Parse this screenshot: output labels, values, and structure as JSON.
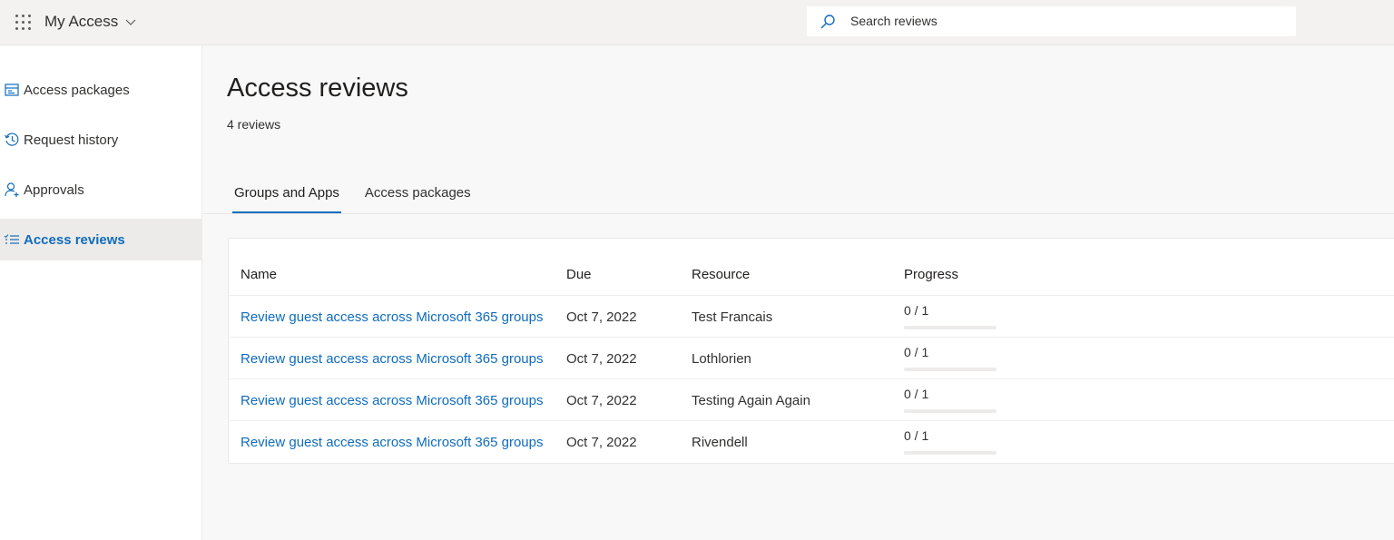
{
  "header": {
    "app_title": "My Access",
    "search_placeholder": "Search reviews"
  },
  "sidebar": {
    "items": [
      {
        "label": "Access packages",
        "icon": "package-icon",
        "active": false
      },
      {
        "label": "Request history",
        "icon": "history-icon",
        "active": false
      },
      {
        "label": "Approvals",
        "icon": "person-add-icon",
        "active": false
      },
      {
        "label": "Access reviews",
        "icon": "checklist-icon",
        "active": true
      }
    ]
  },
  "main": {
    "title": "Access reviews",
    "subtitle": "4 reviews",
    "tabs": [
      {
        "label": "Groups and Apps",
        "active": true
      },
      {
        "label": "Access packages",
        "active": false
      }
    ],
    "table": {
      "columns": [
        "Name",
        "Due",
        "Resource",
        "Progress"
      ],
      "rows": [
        {
          "name": "Review guest access across Microsoft 365 groups",
          "due": "Oct 7, 2022",
          "resource": "Test Francais",
          "progress": "0 / 1",
          "progress_fraction": 0
        },
        {
          "name": "Review guest access across Microsoft 365 groups",
          "due": "Oct 7, 2022",
          "resource": "Lothlorien",
          "progress": "0 / 1",
          "progress_fraction": 0
        },
        {
          "name": "Review guest access across Microsoft 365 groups",
          "due": "Oct 7, 2022",
          "resource": "Testing Again Again",
          "progress": "0 / 1",
          "progress_fraction": 0
        },
        {
          "name": "Review guest access across Microsoft 365 groups",
          "due": "Oct 7, 2022",
          "resource": "Rivendell",
          "progress": "0 / 1",
          "progress_fraction": 0
        }
      ]
    }
  },
  "colors": {
    "accent": "#0f6cbd",
    "topbar_bg": "#f3f2f1",
    "active_nav_bg": "#edebe9"
  }
}
